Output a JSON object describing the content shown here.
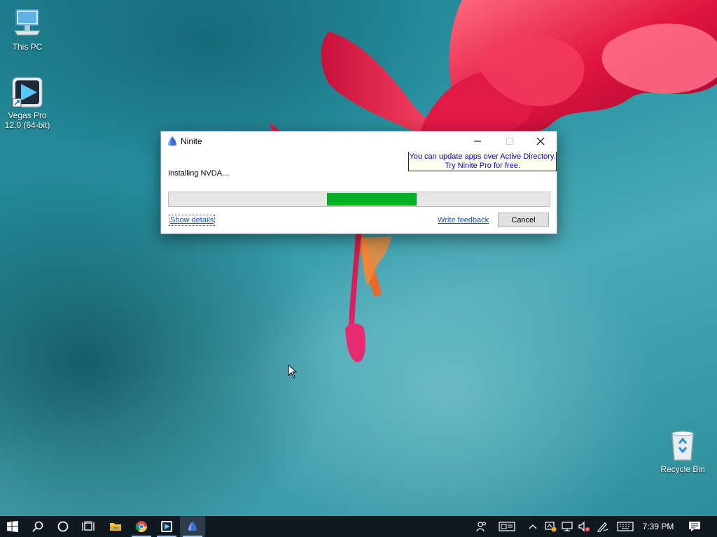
{
  "desktop": {
    "icons": [
      {
        "label": "This PC",
        "icon": "this-pc-icon"
      },
      {
        "label": "Vegas Pro 12.0 (64-bit)",
        "icon": "vegas-pro-icon"
      },
      {
        "label": "Recycle Bin",
        "icon": "recycle-bin-icon"
      }
    ]
  },
  "window": {
    "title": "Ninite",
    "promo_line1": "You can update apps over Active Directory.",
    "promo_line2": "Try Ninite Pro for free.",
    "status": "Installing NVDA...",
    "progress": {
      "segment_start": 0.415,
      "segment_end": 0.65
    },
    "show_details_label": "Show details",
    "feedback_label": "Write feedback",
    "cancel_label": "Cancel",
    "progress_color": "#06b025"
  },
  "taskbar": {
    "apps": [
      "start-icon",
      "search-icon",
      "cortana-icon",
      "task-view-icon",
      "file-explorer-icon",
      "chrome-icon",
      "vegas-pro-icon",
      "ninite-icon"
    ],
    "tray": [
      "people-icon",
      "news-icon",
      "chevron-up-icon",
      "network-warning-icon",
      "network-icon",
      "volume-muted-icon",
      "pen-icon",
      "keyboard-icon",
      "action-center-icon"
    ],
    "clock": "7:39 PM"
  }
}
